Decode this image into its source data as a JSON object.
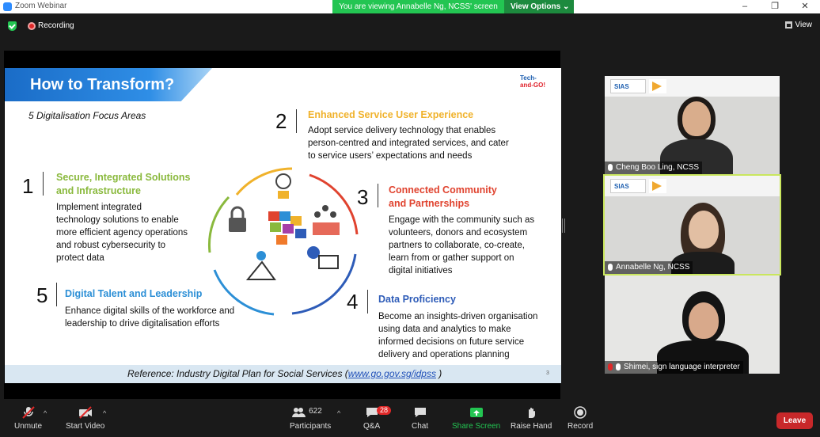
{
  "window": {
    "title": "Zoom Webinar",
    "controls": [
      "–",
      "❐",
      "✕"
    ]
  },
  "banner": {
    "viewing_text": "You are viewing Annabelle Ng, NCSS' screen",
    "view_options": "View Options ⌄"
  },
  "status": {
    "recording": "Recording",
    "view": "View"
  },
  "slide": {
    "title": "How to Transform?",
    "brand": "Tech-and-GO!",
    "subtitle": "5 Digitalisation Focus Areas",
    "areas": [
      {
        "num": "1",
        "title_line1": "Secure, Integrated Solutions",
        "title_line2": "and Infrastructure",
        "color": "#8ab93d",
        "desc": [
          "Implement integrated",
          "technology solutions to enable",
          "more efficient agency operations",
          "and robust cybersecurity to",
          "protect data"
        ]
      },
      {
        "num": "2",
        "title_line1": "Enhanced Service User Experience",
        "title_line2": "",
        "color": "#f0b22b",
        "desc": [
          "Adopt service delivery technology that enables",
          "person-centred and integrated services, and cater",
          "to service users’ expectations and needs"
        ]
      },
      {
        "num": "3",
        "title_line1": "Connected Community",
        "title_line2": "and Partnerships",
        "color": "#e0432f",
        "desc": [
          "Engage with the community such as",
          "volunteers, donors and ecosystem",
          "partners to collaborate, co-create,",
          "learn from or gather support on",
          "digital initiatives"
        ]
      },
      {
        "num": "4",
        "title_line1": "Data Proficiency",
        "title_line2": "",
        "color": "#2e5cb8",
        "desc": [
          "Become an insights-driven organisation",
          "using data and analytics to make",
          "informed decisions on future service",
          "delivery and operations planning"
        ]
      },
      {
        "num": "5",
        "title_line1": "Digital Talent and Leadership",
        "title_line2": "",
        "color": "#2c8fd6",
        "desc": [
          "Enhance digital skills of the workforce and",
          "leadership to drive digitalisation efforts"
        ]
      }
    ],
    "reference_prefix": "Reference: Industry Digital Plan for Social Services (",
    "reference_link": "www.go.gov.sg/idpss",
    "reference_suffix": " )",
    "page_number": "3"
  },
  "participants_video": [
    {
      "name": "Cheng Boo Ling, NCSS",
      "mic_muted": false
    },
    {
      "name": "Annabelle Ng, NCSS",
      "mic_muted": false
    },
    {
      "name": "Shimei, sign language interpreter",
      "mic_muted": true
    }
  ],
  "tiles": {
    "sias_label": "SIAS"
  },
  "toolbar": {
    "unmute": "Unmute",
    "start_video": "Start Video",
    "participants": "Participants",
    "participants_count": "622",
    "qa": "Q&A",
    "qa_badge": "28",
    "chat": "Chat",
    "share_screen": "Share Screen",
    "raise_hand": "Raise Hand",
    "record": "Record",
    "leave": "Leave"
  },
  "colors": {
    "accent_green": "#23c552",
    "leave_red": "#c8282a",
    "active_speaker": "#c9e65e"
  }
}
